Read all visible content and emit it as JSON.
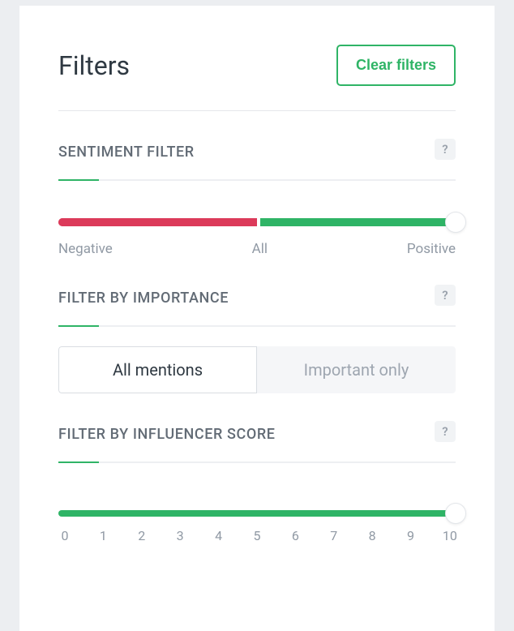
{
  "header": {
    "title": "Filters",
    "clear_button_label": "Clear filters"
  },
  "help_icon_text": "?",
  "sentiment": {
    "title": "SENTIMENT FILTER",
    "labels": {
      "negative": "Negative",
      "all": "All",
      "positive": "Positive"
    },
    "handle_position_pct": 100
  },
  "importance": {
    "title": "FILTER BY IMPORTANCE",
    "options": {
      "all": "All mentions",
      "important": "Important only"
    },
    "selected": "all"
  },
  "influencer": {
    "title": "FILTER BY INFLUENCER SCORE",
    "ticks": [
      "0",
      "1",
      "2",
      "3",
      "4",
      "5",
      "6",
      "7",
      "8",
      "9",
      "10"
    ],
    "handle_position_pct": 100
  },
  "colors": {
    "accent_green": "#2fb466",
    "negative_red": "#dc3a5a",
    "muted_text": "#9099a4",
    "title_text": "#2f3942"
  }
}
